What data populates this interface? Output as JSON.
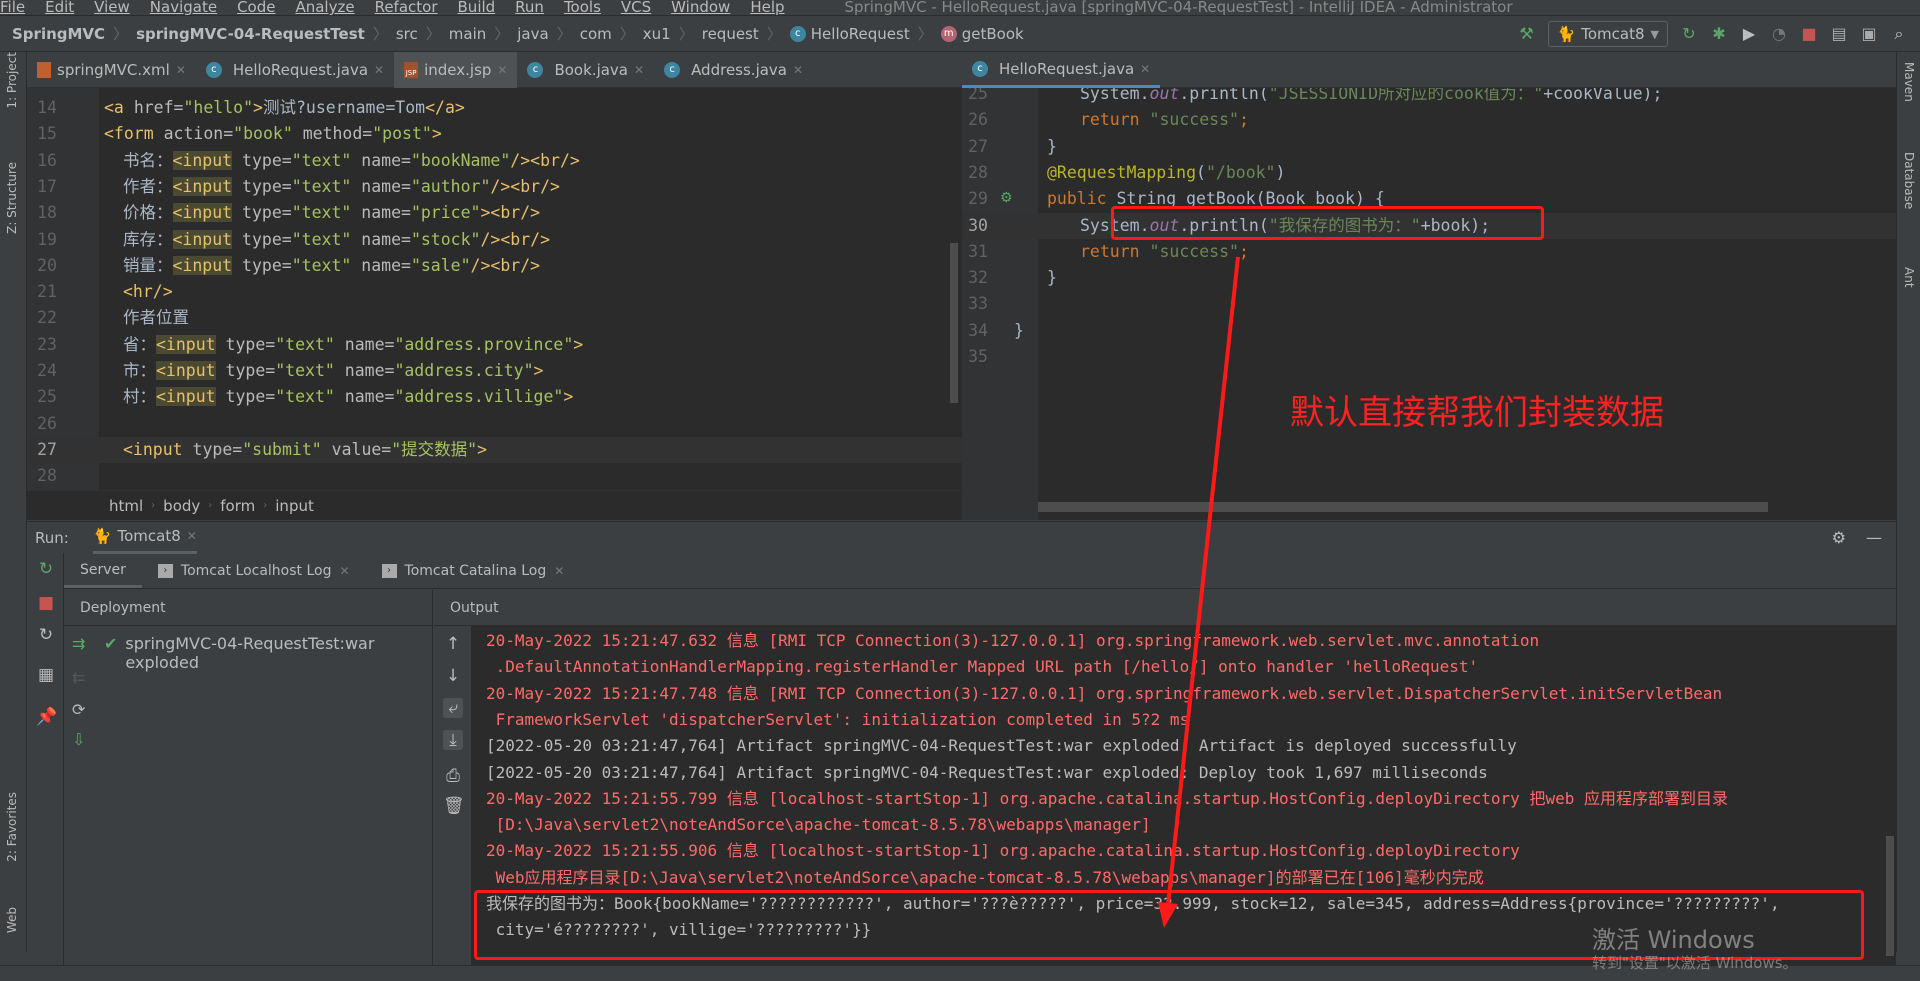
{
  "menu": [
    "File",
    "Edit",
    "View",
    "Navigate",
    "Code",
    "Analyze",
    "Refactor",
    "Build",
    "Run",
    "Tools",
    "VCS",
    "Window",
    "Help"
  ],
  "window_title": "SpringMVC - HelloRequest.java [springMVC-04-RequestTest] - IntelliJ IDEA - Administrator",
  "breadcrumbs": [
    "SpringMVC",
    "springMVC-04-RequestTest",
    "src",
    "main",
    "java",
    "com",
    "xu1",
    "request",
    "HelloRequest",
    "getBook"
  ],
  "run_config": "Tomcat8",
  "left_tabs": [
    {
      "label": "springMVC.xml",
      "icon": "xml-file-icon"
    },
    {
      "label": "HelloRequest.java",
      "icon": "class-icon"
    },
    {
      "label": "index.jsp",
      "icon": "jsp-file-icon",
      "active": true
    },
    {
      "label": "Book.java",
      "icon": "class-icon"
    },
    {
      "label": "Address.java",
      "icon": "class-icon"
    }
  ],
  "right_tabs": [
    {
      "label": "HelloRequest.java",
      "icon": "class-icon",
      "active": true
    }
  ],
  "left_strip": {
    "project": "1: Project",
    "structure": "Z: Structure",
    "favorites": "2: Favorites",
    "web": "Web"
  },
  "right_strip": {
    "maven": "Maven",
    "database": "Database",
    "ant": "Ant"
  },
  "jsp_editor": {
    "current_line": 27,
    "lines": [
      {
        "n": 14,
        "indent": 1,
        "tokens": [
          {
            "t": "<a ",
            "k": "tag"
          },
          {
            "t": "href=",
            "k": "attr"
          },
          {
            "t": "\"hello\"",
            "k": "str"
          },
          {
            "t": ">",
            "k": "tag"
          },
          {
            "t": "测试?username=Tom",
            "k": "text"
          },
          {
            "t": "</a>",
            "k": "tag"
          }
        ]
      },
      {
        "n": 15,
        "indent": 1,
        "tokens": [
          {
            "t": "<form ",
            "k": "tag"
          },
          {
            "t": "action=",
            "k": "attr"
          },
          {
            "t": "\"book\"",
            "k": "str"
          },
          {
            "t": " method=",
            "k": "attr"
          },
          {
            "t": "\"post\"",
            "k": "str"
          },
          {
            "t": ">",
            "k": "tag"
          }
        ]
      },
      {
        "n": 16,
        "indent": 2,
        "tokens": [
          {
            "t": "书名：",
            "k": "text"
          },
          {
            "t": "<input",
            "k": "hl"
          },
          {
            "t": " type=",
            "k": "attr"
          },
          {
            "t": "\"text\"",
            "k": "str"
          },
          {
            "t": " name=",
            "k": "attr"
          },
          {
            "t": "\"bookName\"",
            "k": "str"
          },
          {
            "t": "/><br/>",
            "k": "tag"
          }
        ]
      },
      {
        "n": 17,
        "indent": 2,
        "tokens": [
          {
            "t": "作者：",
            "k": "text"
          },
          {
            "t": "<input",
            "k": "hl"
          },
          {
            "t": " type=",
            "k": "attr"
          },
          {
            "t": "\"text\"",
            "k": "str"
          },
          {
            "t": " name=",
            "k": "attr"
          },
          {
            "t": "\"author\"",
            "k": "str"
          },
          {
            "t": "/><br/>",
            "k": "tag"
          }
        ]
      },
      {
        "n": 18,
        "indent": 2,
        "tokens": [
          {
            "t": "价格：",
            "k": "text"
          },
          {
            "t": "<input",
            "k": "hl"
          },
          {
            "t": " type=",
            "k": "attr"
          },
          {
            "t": "\"text\"",
            "k": "str"
          },
          {
            "t": " name=",
            "k": "attr"
          },
          {
            "t": "\"price\"",
            "k": "str"
          },
          {
            "t": "><br/>",
            "k": "tag"
          }
        ]
      },
      {
        "n": 19,
        "indent": 2,
        "tokens": [
          {
            "t": "库存：",
            "k": "text"
          },
          {
            "t": "<input",
            "k": "hl"
          },
          {
            "t": " type=",
            "k": "attr"
          },
          {
            "t": "\"text\"",
            "k": "str"
          },
          {
            "t": " name=",
            "k": "attr"
          },
          {
            "t": "\"stock\"",
            "k": "str"
          },
          {
            "t": "/><br/>",
            "k": "tag"
          }
        ]
      },
      {
        "n": 20,
        "indent": 2,
        "tokens": [
          {
            "t": "销量：",
            "k": "text"
          },
          {
            "t": "<input",
            "k": "hl"
          },
          {
            "t": " type=",
            "k": "attr"
          },
          {
            "t": "\"text\"",
            "k": "str"
          },
          {
            "t": " name=",
            "k": "attr"
          },
          {
            "t": "\"sale\"",
            "k": "str"
          },
          {
            "t": "/><br/>",
            "k": "tag"
          }
        ]
      },
      {
        "n": 21,
        "indent": 2,
        "tokens": [
          {
            "t": "<hr/>",
            "k": "tag"
          }
        ]
      },
      {
        "n": 22,
        "indent": 2,
        "tokens": [
          {
            "t": "作者位置",
            "k": "text"
          }
        ]
      },
      {
        "n": 23,
        "indent": 2,
        "tokens": [
          {
            "t": "省：",
            "k": "text"
          },
          {
            "t": "<input",
            "k": "hl"
          },
          {
            "t": " type=",
            "k": "attr"
          },
          {
            "t": "\"text\"",
            "k": "str"
          },
          {
            "t": " name=",
            "k": "attr"
          },
          {
            "t": "\"address.province\"",
            "k": "str"
          },
          {
            "t": ">",
            "k": "tag"
          }
        ]
      },
      {
        "n": 24,
        "indent": 2,
        "tokens": [
          {
            "t": "市：",
            "k": "text"
          },
          {
            "t": "<input",
            "k": "hl"
          },
          {
            "t": " type=",
            "k": "attr"
          },
          {
            "t": "\"text\"",
            "k": "str"
          },
          {
            "t": " name=",
            "k": "attr"
          },
          {
            "t": "\"address.city\"",
            "k": "str"
          },
          {
            "t": ">",
            "k": "tag"
          }
        ]
      },
      {
        "n": 25,
        "indent": 2,
        "tokens": [
          {
            "t": "村：",
            "k": "text"
          },
          {
            "t": "<input",
            "k": "hl"
          },
          {
            "t": " type=",
            "k": "attr"
          },
          {
            "t": "\"text\"",
            "k": "str"
          },
          {
            "t": " name=",
            "k": "attr"
          },
          {
            "t": "\"address.villige\"",
            "k": "str"
          },
          {
            "t": ">",
            "k": "tag"
          }
        ]
      },
      {
        "n": 26,
        "indent": 2,
        "tokens": []
      },
      {
        "n": 27,
        "indent": 2,
        "tokens": [
          {
            "t": "<input ",
            "k": "tag"
          },
          {
            "t": "type=",
            "k": "attr"
          },
          {
            "t": "\"submit\"",
            "k": "str"
          },
          {
            "t": " value=",
            "k": "attr"
          },
          {
            "t": "\"提交数据\"",
            "k": "str"
          },
          {
            "t": ">",
            "k": "tag"
          }
        ]
      },
      {
        "n": 28,
        "indent": 0,
        "tokens": []
      }
    ],
    "breadcrumb": [
      "html",
      "body",
      "form",
      "input"
    ]
  },
  "java_editor": {
    "current_line": 30,
    "lines": [
      {
        "n": 25,
        "indent": 2,
        "tokens": [
          {
            "t": "System.",
            "k": "text"
          },
          {
            "t": "out",
            "k": "field"
          },
          {
            "t": ".println(",
            "k": "text"
          },
          {
            "t": "\"JSESSIONID所对应的cook值为：\"",
            "k": "jstr"
          },
          {
            "t": "+cookValue);",
            "k": "text"
          }
        ]
      },
      {
        "n": 26,
        "indent": 2,
        "tokens": [
          {
            "t": "return ",
            "k": "kw"
          },
          {
            "t": "\"success\"",
            "k": "jstr"
          },
          {
            "t": ";",
            "k": "kw"
          }
        ]
      },
      {
        "n": 27,
        "indent": 1,
        "tokens": [
          {
            "t": "}",
            "k": "text"
          }
        ]
      },
      {
        "n": 28,
        "indent": 1,
        "tokens": [
          {
            "t": "@RequestMapping",
            "k": "ann"
          },
          {
            "t": "(",
            "k": "text"
          },
          {
            "t": "\"/book\"",
            "k": "jstr"
          },
          {
            "t": ")",
            "k": "text"
          }
        ]
      },
      {
        "n": 29,
        "indent": 1,
        "tokens": [
          {
            "t": "public ",
            "k": "kw"
          },
          {
            "t": "String getBook(Book book) {",
            "k": "text"
          }
        ]
      },
      {
        "n": 30,
        "indent": 2,
        "tokens": [
          {
            "t": "System.",
            "k": "text"
          },
          {
            "t": "out",
            "k": "field"
          },
          {
            "t": ".println(",
            "k": "text"
          },
          {
            "t": "\"我保存的图书为：\"",
            "k": "jstr"
          },
          {
            "t": "+book);",
            "k": "text"
          }
        ]
      },
      {
        "n": 31,
        "indent": 2,
        "tokens": [
          {
            "t": "return ",
            "k": "kw"
          },
          {
            "t": "\"success\"",
            "k": "jstr"
          },
          {
            "t": ";",
            "k": "kw"
          }
        ]
      },
      {
        "n": 32,
        "indent": 1,
        "tokens": [
          {
            "t": "}",
            "k": "text"
          }
        ]
      },
      {
        "n": 33,
        "indent": 0,
        "tokens": []
      },
      {
        "n": 34,
        "indent": 0,
        "tokens": [
          {
            "t": "}",
            "k": "text"
          }
        ]
      },
      {
        "n": 35,
        "indent": 0,
        "tokens": []
      }
    ]
  },
  "run": {
    "label": "Run:",
    "tab": "Tomcat8",
    "subtabs": [
      "Server",
      "Tomcat Localhost Log",
      "Tomcat Catalina Log"
    ],
    "deployment_header": "Deployment",
    "deployment_item": "springMVC-04-RequestTest:war exploded",
    "output_header": "Output",
    "output": [
      {
        "text": "20-May-2022 15:21:47.632 信息 [RMI TCP Connection(3)-127.0.0.1] org.springframework.web.servlet.mvc.annotation",
        "kind": "err"
      },
      {
        "text": " .DefaultAnnotationHandlerMapping.registerHandler Mapped URL path [/hello/] onto handler 'helloRequest'",
        "kind": "err"
      },
      {
        "text": "20-May-2022 15:21:47.748 信息 [RMI TCP Connection(3)-127.0.0.1] org.springframework.web.servlet.DispatcherServlet.initServletBean",
        "kind": "err"
      },
      {
        "text": " FrameworkServlet 'dispatcherServlet': initialization completed in 5?2 ms",
        "kind": "err"
      },
      {
        "text": "[2022-05-20 03:21:47,764] Artifact springMVC-04-RequestTest:war exploded: Artifact is deployed successfully",
        "kind": "norm"
      },
      {
        "text": "[2022-05-20 03:21:47,764] Artifact springMVC-04-RequestTest:war exploded: Deploy took 1,697 milliseconds",
        "kind": "norm"
      },
      {
        "text": "20-May-2022 15:21:55.799 信息 [localhost-startStop-1] org.apache.catalina.startup.HostConfig.deployDirectory 把web 应用程序部署到目录",
        "kind": "err"
      },
      {
        "text": " [D:\\Java\\servlet2\\noteAndSorce\\apache-tomcat-8.5.78\\webapps\\manager]",
        "kind": "err"
      },
      {
        "text": "20-May-2022 15:21:55.906 信息 [localhost-startStop-1] org.apache.catalina.startup.HostConfig.deployDirectory",
        "kind": "err"
      },
      {
        "text": " Web应用程序目录[D:\\Java\\servlet2\\noteAndSorce\\apache-tomcat-8.5.78\\webapps\\manager]的部署已在[106]毫秒内完成",
        "kind": "err"
      },
      {
        "text": "我保存的图书为：Book{bookName='????????????', author='???è?????', price=32.999, stock=12, sale=345, address=Address{province='?????????',",
        "kind": "norm"
      },
      {
        "text": " city='é????????', villige='?????????'}}",
        "kind": "norm"
      }
    ]
  },
  "annotation": {
    "text": "默认直接帮我们封装数据",
    "color": "#ff2222"
  },
  "watermark": {
    "title": "激活 Windows",
    "subtitle": "转到\"设置\"以激活 Windows。"
  },
  "colors": {
    "editor_bg": "#2b2b2b",
    "panel_bg": "#3c3f41",
    "annotation_red": "#ff1a1a",
    "error_output": "#ff6b68"
  }
}
